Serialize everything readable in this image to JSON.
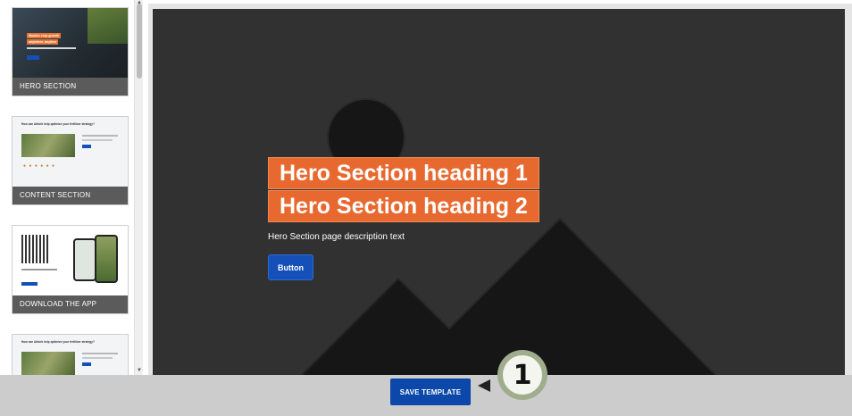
{
  "sidebar": {
    "templates": [
      {
        "label": "HERO SECTION",
        "thumb": {
          "line1": "Monitor crop growth",
          "line2": "anywhere, anytime"
        }
      },
      {
        "label": "CONTENT SECTION",
        "thumb": {
          "title": "How can Airbnb help optimize your fertiliser strategy?"
        }
      },
      {
        "label": "DOWNLOAD THE APP",
        "thumb": {}
      },
      {
        "label": "",
        "thumb": {
          "title": "How can Airbnb help optimize your fertiliser strategy?"
        }
      }
    ]
  },
  "preview": {
    "heading_1": "Hero Section heading 1",
    "heading_2": "Hero Section heading 2",
    "description": "Hero Section page description text",
    "button_label": "Button"
  },
  "footer": {
    "save_label": "SAVE TEMPLATE",
    "step_number": "1"
  },
  "colors": {
    "heading_bg": "#e8692f",
    "button_bg": "#1450b7",
    "save_bg": "#0b48a9",
    "preview_bg": "#313131",
    "caption_bg": "#5b5b5b"
  }
}
